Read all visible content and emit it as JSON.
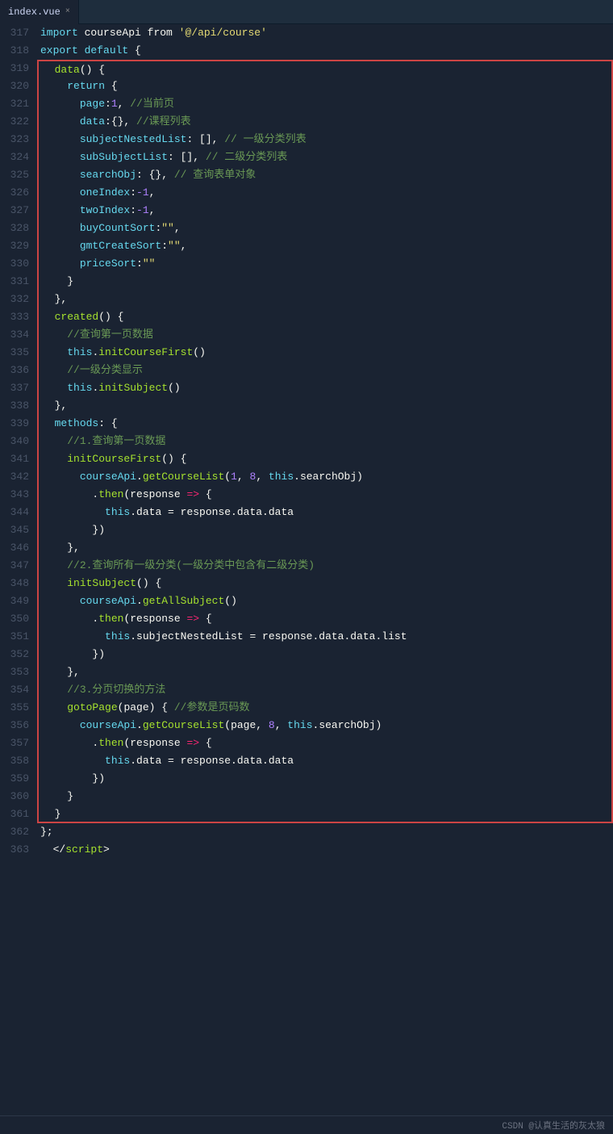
{
  "tab": {
    "filename": "index.vue",
    "close_label": "×"
  },
  "lines": [
    {
      "num": 317,
      "content": "import_courseApi_from_path",
      "highlight": false
    },
    {
      "num": 318,
      "content": "export_default_open",
      "highlight": false
    },
    {
      "num": 319,
      "content": "data_fn_open",
      "highlight": "start"
    },
    {
      "num": 320,
      "content": "return_open",
      "highlight": "mid"
    },
    {
      "num": 321,
      "content": "page_1_comment",
      "highlight": "mid"
    },
    {
      "num": 322,
      "content": "data_empty_comment",
      "highlight": "mid"
    },
    {
      "num": 323,
      "content": "subjectNestedList",
      "highlight": "mid"
    },
    {
      "num": 324,
      "content": "subSubjectList",
      "highlight": "mid"
    },
    {
      "num": 325,
      "content": "searchObj",
      "highlight": "mid"
    },
    {
      "num": 326,
      "content": "oneIndex",
      "highlight": "mid"
    },
    {
      "num": 327,
      "content": "twoIndex",
      "highlight": "mid"
    },
    {
      "num": 328,
      "content": "buyCountSort",
      "highlight": "mid"
    },
    {
      "num": 329,
      "content": "gmtCreateSort",
      "highlight": "mid"
    },
    {
      "num": 330,
      "content": "priceSort",
      "highlight": "mid"
    },
    {
      "num": 331,
      "content": "close_inner",
      "highlight": "mid"
    },
    {
      "num": 332,
      "content": "close_data",
      "highlight": "mid"
    },
    {
      "num": 333,
      "content": "created_fn",
      "highlight": "mid"
    },
    {
      "num": 334,
      "content": "comment_query_first",
      "highlight": "mid"
    },
    {
      "num": 335,
      "content": "init_course_first",
      "highlight": "mid"
    },
    {
      "num": 336,
      "content": "comment_subject",
      "highlight": "mid"
    },
    {
      "num": 337,
      "content": "init_subject",
      "highlight": "mid"
    },
    {
      "num": 338,
      "content": "close_created",
      "highlight": "mid"
    },
    {
      "num": 339,
      "content": "methods_open",
      "highlight": "mid"
    },
    {
      "num": 340,
      "content": "comment_1",
      "highlight": "mid"
    },
    {
      "num": 341,
      "content": "initCourseFirst_def",
      "highlight": "mid"
    },
    {
      "num": 342,
      "content": "getCourseList_call",
      "highlight": "mid"
    },
    {
      "num": 343,
      "content": "then_response",
      "highlight": "mid"
    },
    {
      "num": 344,
      "content": "this_data_assign",
      "highlight": "mid"
    },
    {
      "num": 345,
      "content": "close_then",
      "highlight": "mid"
    },
    {
      "num": 346,
      "content": "close_initCourseFirst",
      "highlight": "mid"
    },
    {
      "num": 347,
      "content": "comment_2",
      "highlight": "mid"
    },
    {
      "num": 348,
      "content": "initSubject_def",
      "highlight": "mid"
    },
    {
      "num": 349,
      "content": "getAllSubject_call",
      "highlight": "mid"
    },
    {
      "num": 350,
      "content": "then_response2",
      "highlight": "mid"
    },
    {
      "num": 351,
      "content": "this_subjectNested",
      "highlight": "mid"
    },
    {
      "num": 352,
      "content": "close_then2",
      "highlight": "mid"
    },
    {
      "num": 353,
      "content": "close_initSubject",
      "highlight": "mid"
    },
    {
      "num": 354,
      "content": "comment_3",
      "highlight": "mid"
    },
    {
      "num": 355,
      "content": "gotoPage_def",
      "highlight": "mid"
    },
    {
      "num": 356,
      "content": "getCourseList_page",
      "highlight": "mid"
    },
    {
      "num": 357,
      "content": "then_response3",
      "highlight": "mid"
    },
    {
      "num": 358,
      "content": "this_data_assign2",
      "highlight": "mid"
    },
    {
      "num": 359,
      "content": "close_then3",
      "highlight": "mid"
    },
    {
      "num": 360,
      "content": "close_gotoPage",
      "highlight": "mid"
    },
    {
      "num": 361,
      "content": "close_methods",
      "highlight": "end"
    },
    {
      "num": 362,
      "content": "close_export",
      "highlight": false
    },
    {
      "num": 363,
      "content": "close_script",
      "highlight": false
    }
  ],
  "status_bar": {
    "text": "CSDN @认真生活的灰太狼"
  }
}
